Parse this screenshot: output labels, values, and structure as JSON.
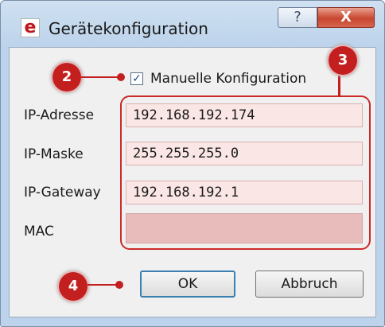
{
  "window": {
    "app_icon_letter": "e",
    "title": "Gerätekonfiguration",
    "help_glyph": "?",
    "close_glyph": "X"
  },
  "manual_config": {
    "label": "Manuelle Konfiguration",
    "checked": true,
    "check_glyph": "✓"
  },
  "fields": {
    "ip_address": {
      "label": "IP-Adresse",
      "value": "192.168.192.174"
    },
    "ip_mask": {
      "label": "IP-Maske",
      "value": "255.255.255.0"
    },
    "ip_gateway": {
      "label": "IP-Gateway",
      "value": "192.168.192.1"
    },
    "mac": {
      "label": "MAC",
      "value": ""
    }
  },
  "buttons": {
    "ok": "OK",
    "cancel": "Abbruch"
  },
  "annotations": {
    "badge_2": "2",
    "badge_3": "3",
    "badge_4": "4"
  },
  "colors": {
    "annotation_red": "#c41f1f",
    "field_highlight": "#fbe6e6"
  }
}
